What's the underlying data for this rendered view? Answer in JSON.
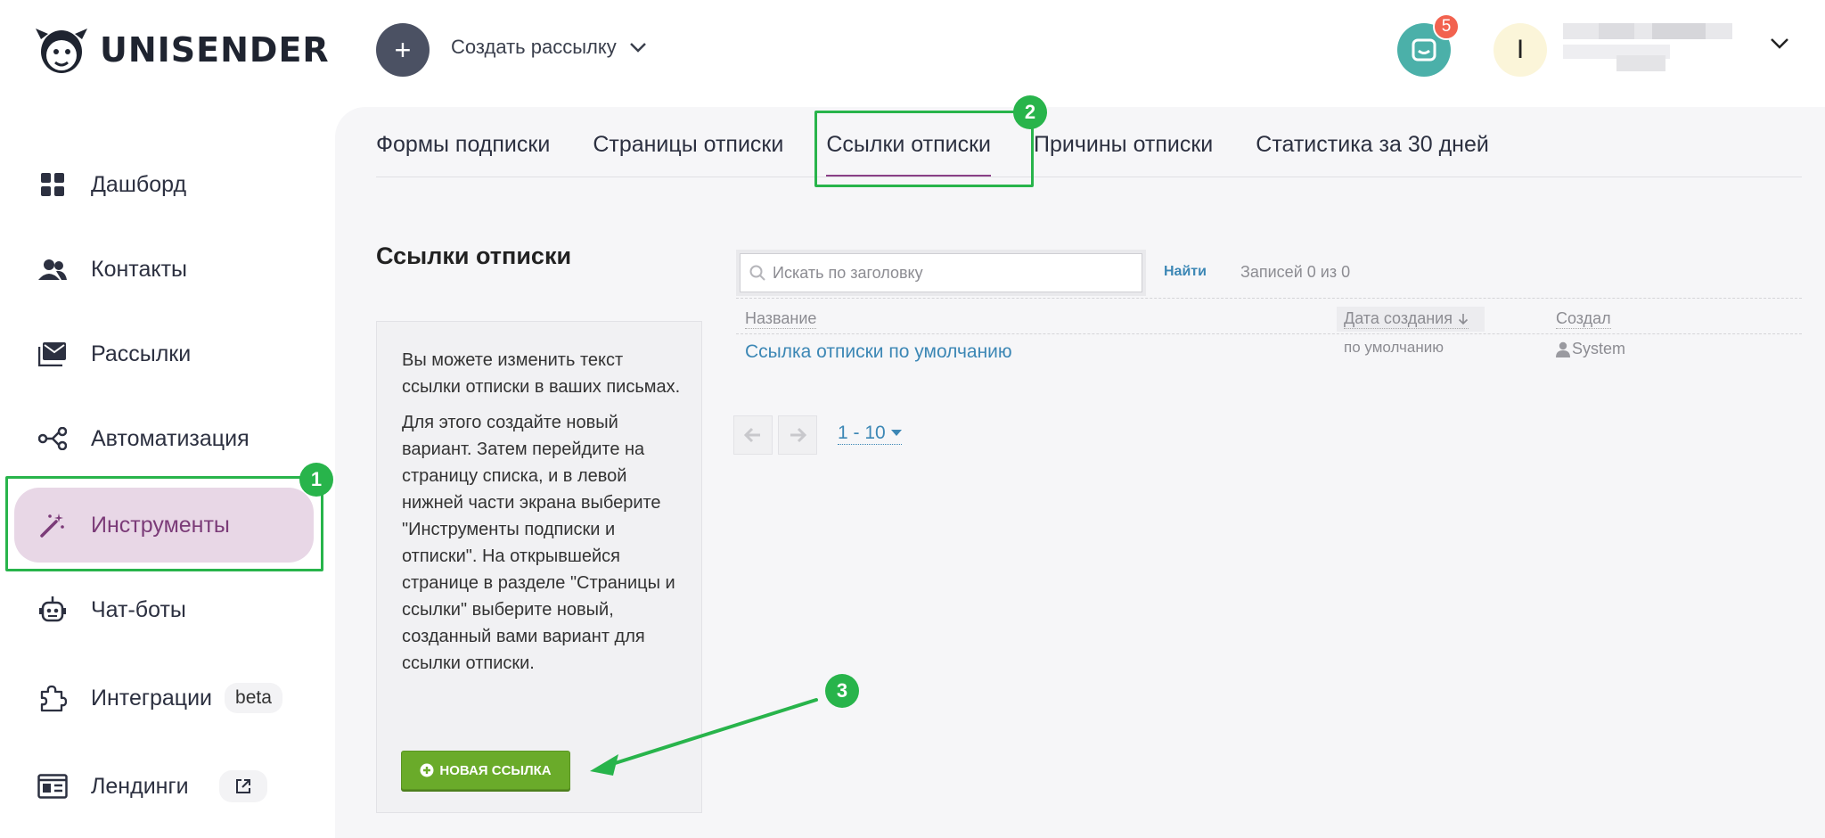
{
  "header": {
    "logo_text": "UNISENDER",
    "create_button_icon": "+",
    "create_label": "Создать рассылку",
    "notifications_count": "5",
    "avatar_letter": "I"
  },
  "sidebar": {
    "items": [
      {
        "label": "Дашборд",
        "icon": "dashboard-icon"
      },
      {
        "label": "Контакты",
        "icon": "contacts-icon"
      },
      {
        "label": "Рассылки",
        "icon": "mail-icon"
      },
      {
        "label": "Автоматизация",
        "icon": "automation-icon"
      },
      {
        "label": "Инструменты",
        "icon": "magic-wand-icon",
        "active": true
      },
      {
        "label": "Чат-боты",
        "icon": "robot-icon"
      },
      {
        "label": "Интеграции",
        "icon": "puzzle-icon",
        "pill": "beta"
      },
      {
        "label": "Лендинги",
        "icon": "landing-icon",
        "pill_icon": "external-link-icon"
      }
    ]
  },
  "tabs": [
    {
      "label": "Формы подписки"
    },
    {
      "label": "Страницы отписки"
    },
    {
      "label": "Ссылки отписки",
      "active": true
    },
    {
      "label": "Причины отписки"
    },
    {
      "label": "Статистика за 30 дней"
    }
  ],
  "main": {
    "title": "Ссылки отписки",
    "info_p1": "Вы можете изменить текст ссылки отписки в ваших письмах.",
    "info_p2": "Для этого создайте новый вариант. Затем перейдите на страницу списка, и в левой нижней части экрана выберите \"Инструменты подписки и отписки\". На открывшейся странице в разделе \"Страницы и ссылки\" выберите новый, созданный вами вариант для ссылки отписки.",
    "new_link_button": "НОВАЯ ССЫЛКА",
    "search_placeholder": "Искать по заголовку",
    "find_button": "Найти",
    "records_text": "Записей 0 из 0",
    "columns": {
      "name": "Название",
      "date": "Дата создания",
      "creator": "Создал"
    },
    "rows": [
      {
        "name": "Ссылка отписки по умолчанию",
        "date": "по умолчанию",
        "creator": "System"
      }
    ],
    "pagination_range": "1 - 10"
  },
  "annotations": {
    "marker1": "1",
    "marker2": "2",
    "marker3": "3"
  },
  "colors": {
    "accent": "#7b3b78",
    "active_bg": "#e8d7e6",
    "link": "#3c87b5",
    "annotation": "#28b44b",
    "button_green": "#6aab2a",
    "support": "#4bb0a9",
    "badge": "#f2624f"
  }
}
